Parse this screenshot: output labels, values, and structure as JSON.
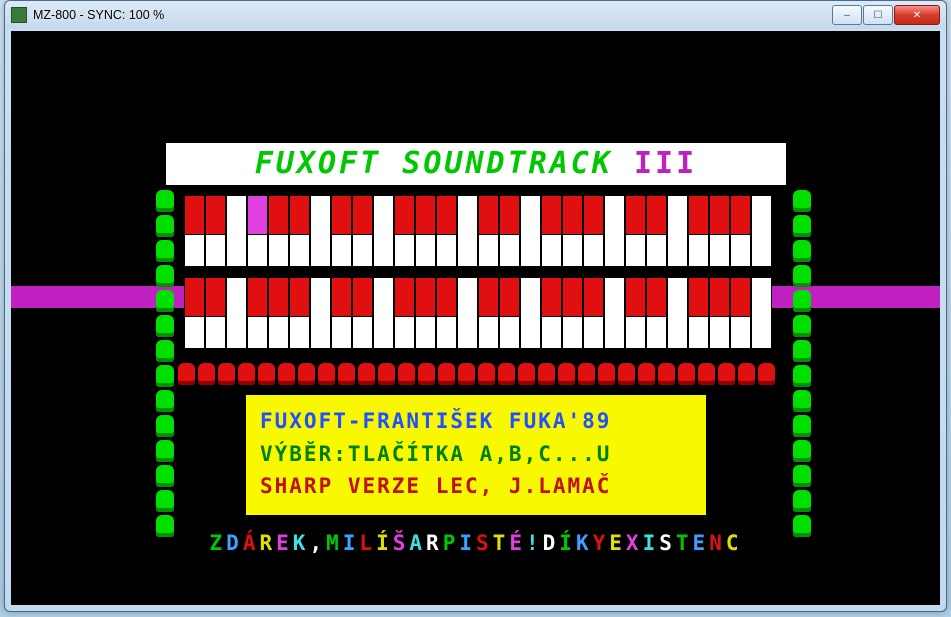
{
  "window_title": "MZ-800 - SYNC: 100 %",
  "banner": {
    "main": "FUXOFT SOUNDTRACK",
    "suffix": "III"
  },
  "info": {
    "line1": "FUXOFT-FRANTIŠEK FUKA'89",
    "line2": "VÝBĚR:TLAČÍTKA A,B,C...U",
    "line3": "SHARP VERZE LEC, J.LAMAČ"
  },
  "scroller": [
    {
      "t": "Z",
      "c": "#00c800"
    },
    {
      "t": "D",
      "c": "#40a0ff"
    },
    {
      "t": "Á",
      "c": "#e01010"
    },
    {
      "t": "R",
      "c": "#e0e000"
    },
    {
      "t": "E",
      "c": "#e040e0"
    },
    {
      "t": "K",
      "c": "#40e0e0"
    },
    {
      "t": ", ",
      "c": "#ffffff"
    },
    {
      "t": "M",
      "c": "#00c800"
    },
    {
      "t": "I",
      "c": "#40a0ff"
    },
    {
      "t": "L",
      "c": "#e01010"
    },
    {
      "t": "Í",
      "c": "#e0e000"
    },
    {
      "t": " ",
      "c": "#ffffff"
    },
    {
      "t": "Š",
      "c": "#e040e0"
    },
    {
      "t": "A",
      "c": "#40e0e0"
    },
    {
      "t": "R",
      "c": "#ffffff"
    },
    {
      "t": "P",
      "c": "#00c800"
    },
    {
      "t": "I",
      "c": "#40a0ff"
    },
    {
      "t": "S",
      "c": "#e01010"
    },
    {
      "t": "T",
      "c": "#e0e000"
    },
    {
      "t": "É",
      "c": "#e040e0"
    },
    {
      "t": "!",
      "c": "#40e0e0"
    },
    {
      "t": "    ",
      "c": "#ffffff"
    },
    {
      "t": "D",
      "c": "#ffffff"
    },
    {
      "t": "Í",
      "c": "#00c800"
    },
    {
      "t": "K",
      "c": "#40a0ff"
    },
    {
      "t": "Y",
      "c": "#e01010"
    },
    {
      "t": " ",
      "c": "#ffffff"
    },
    {
      "t": "E",
      "c": "#e0e000"
    },
    {
      "t": "X",
      "c": "#e040e0"
    },
    {
      "t": "I",
      "c": "#40e0e0"
    },
    {
      "t": "S",
      "c": "#ffffff"
    },
    {
      "t": "T",
      "c": "#00c800"
    },
    {
      "t": "E",
      "c": "#40a0ff"
    },
    {
      "t": "N",
      "c": "#e01010"
    },
    {
      "t": "C",
      "c": "#e0e000"
    }
  ],
  "side_tube_count": 14,
  "red_pill_count": 30,
  "keyboard": {
    "white_count": 28,
    "black_pattern": [
      "kb",
      "kb",
      "gap",
      "kb",
      "kb",
      "kb",
      "gap",
      "kb",
      "kb",
      "gap",
      "kb",
      "kb",
      "kb",
      "gap",
      "kb",
      "kb",
      "gap",
      "kb",
      "kb",
      "kb",
      "gap",
      "kb",
      "kb",
      "gap",
      "kb",
      "kb",
      "kb",
      "gap"
    ],
    "highlighted_black_index_top": 3
  },
  "window_buttons": {
    "minimize": "–",
    "maximize": "☐",
    "close": "✕"
  }
}
